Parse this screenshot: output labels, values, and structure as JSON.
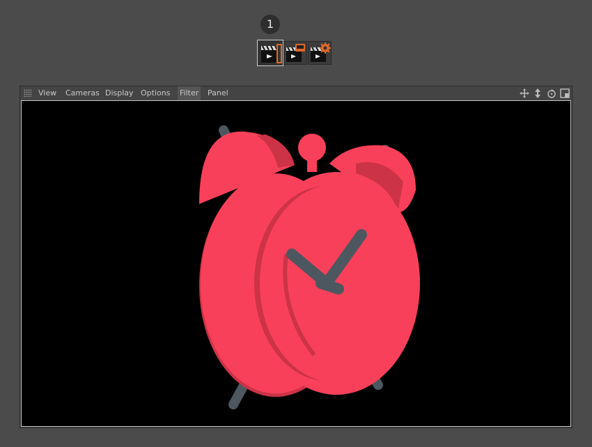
{
  "step_number": "1",
  "toolbar": {
    "buttons": [
      {
        "name": "render-view-button",
        "active": true
      },
      {
        "name": "render-to-picture-viewer-button",
        "active": false
      },
      {
        "name": "render-settings-button",
        "active": false
      }
    ]
  },
  "viewport_panel": {
    "menu": [
      "View",
      "Cameras",
      "Display",
      "Options",
      "Filter",
      "Panel"
    ],
    "active_menu": "Filter",
    "nav_icons": [
      "move-icon",
      "zoom-icon",
      "rotate-icon",
      "toggle-view-icon"
    ]
  },
  "scene": {
    "object": "alarm-clock",
    "body_color": "#f9405a",
    "shade_color": "#cc3346",
    "hands_color": "#4d575f",
    "background": "#000000"
  }
}
